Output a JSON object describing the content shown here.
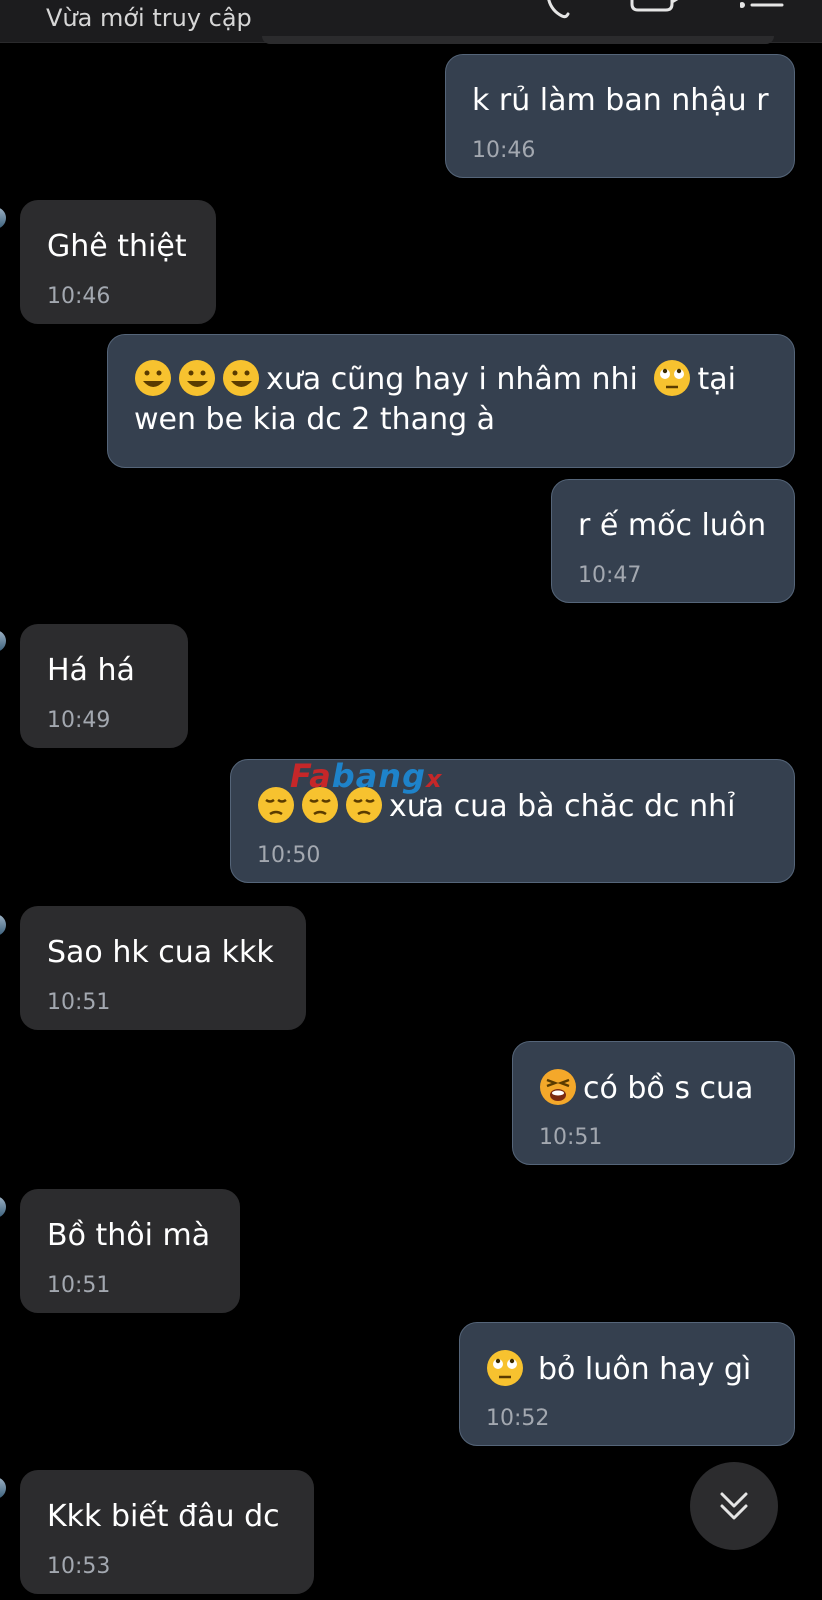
{
  "header": {
    "status": "Vừa mới truy cập",
    "icons": [
      "phone-icon",
      "video-icon",
      "menu-icon"
    ]
  },
  "colors": {
    "background": "#000000",
    "incoming_bubble": "#2c2c2e",
    "outgoing_bubble": "#35404f",
    "outgoing_border": "#556579",
    "timestamp": "#a3a8b0",
    "emoji_yellow": "#f7c22f"
  },
  "messages": [
    {
      "side": "outgoing",
      "text": "k rủ làm ban nhậu r",
      "time": "10:46"
    },
    {
      "side": "incoming",
      "text": "Ghê thiệt",
      "time": "10:46"
    },
    {
      "side": "outgoing",
      "emojis": [
        "grinning-smirk-emoji",
        "grinning-smirk-emoji",
        "grinning-smirk-emoji"
      ],
      "text": "xưa cũng hay i nhâm nhi",
      "emoji_after": "eye-roll-emoji",
      "text2": "tại wen be kia dc 2 thang à"
    },
    {
      "side": "outgoing",
      "text": "r ế mốc luôn",
      "time": "10:47"
    },
    {
      "side": "incoming",
      "text": "Há há",
      "time": "10:49"
    },
    {
      "side": "outgoing",
      "emojis": [
        "pensive-emoji",
        "pensive-emoji",
        "pensive-emoji"
      ],
      "text": "xưa cua bà chăc dc nhỉ",
      "time": "10:50"
    },
    {
      "side": "incoming",
      "text": "Sao hk cua kkk",
      "time": "10:51"
    },
    {
      "side": "outgoing",
      "emojis": [
        "tired-face-emoji"
      ],
      "text": "có bồ s cua",
      "time": "10:51"
    },
    {
      "side": "incoming",
      "text": "Bồ thôi mà",
      "time": "10:51"
    },
    {
      "side": "outgoing",
      "emojis": [
        "eye-roll-emoji"
      ],
      "text": "bỏ luôn hay gì",
      "time": "10:52"
    },
    {
      "side": "incoming",
      "text": "Kkk biết đâu dc",
      "time": "10:53"
    }
  ],
  "watermark": {
    "part1": "Fa",
    "part2": "bang",
    "part3": "x"
  },
  "scroll_button": {
    "icon": "double-chevron-down-icon"
  }
}
